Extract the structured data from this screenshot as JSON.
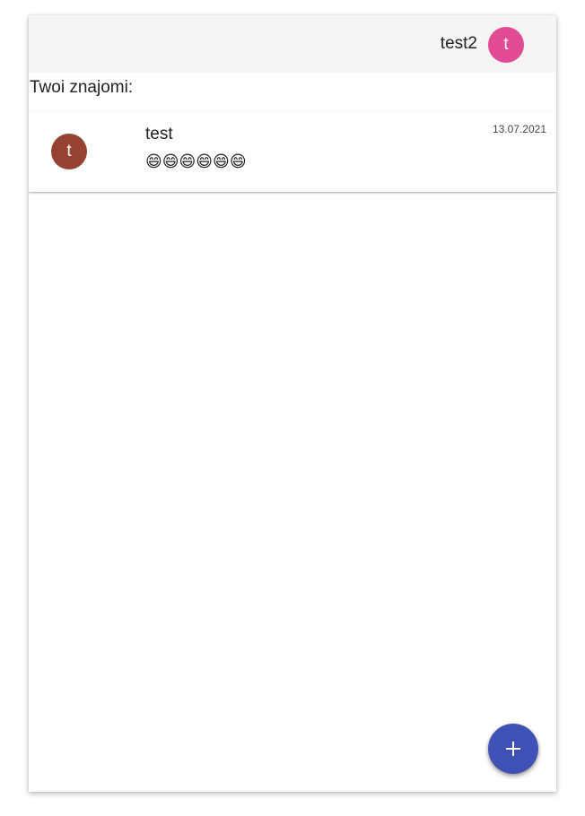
{
  "colors": {
    "header_avatar": "#e04b94",
    "friend_avatar": "#964232",
    "fab": "#3f51b5",
    "header_bg": "#f5f5f5"
  },
  "header": {
    "username": "test2",
    "avatar_letter": "t"
  },
  "section_title": "Twoi znajomi:",
  "friends": [
    {
      "name": "test",
      "avatar_letter": "t",
      "last_message": "😄😄😄😄😄😄",
      "date": "13.07.2021"
    }
  ],
  "fab": {
    "icon": "plus-icon"
  }
}
